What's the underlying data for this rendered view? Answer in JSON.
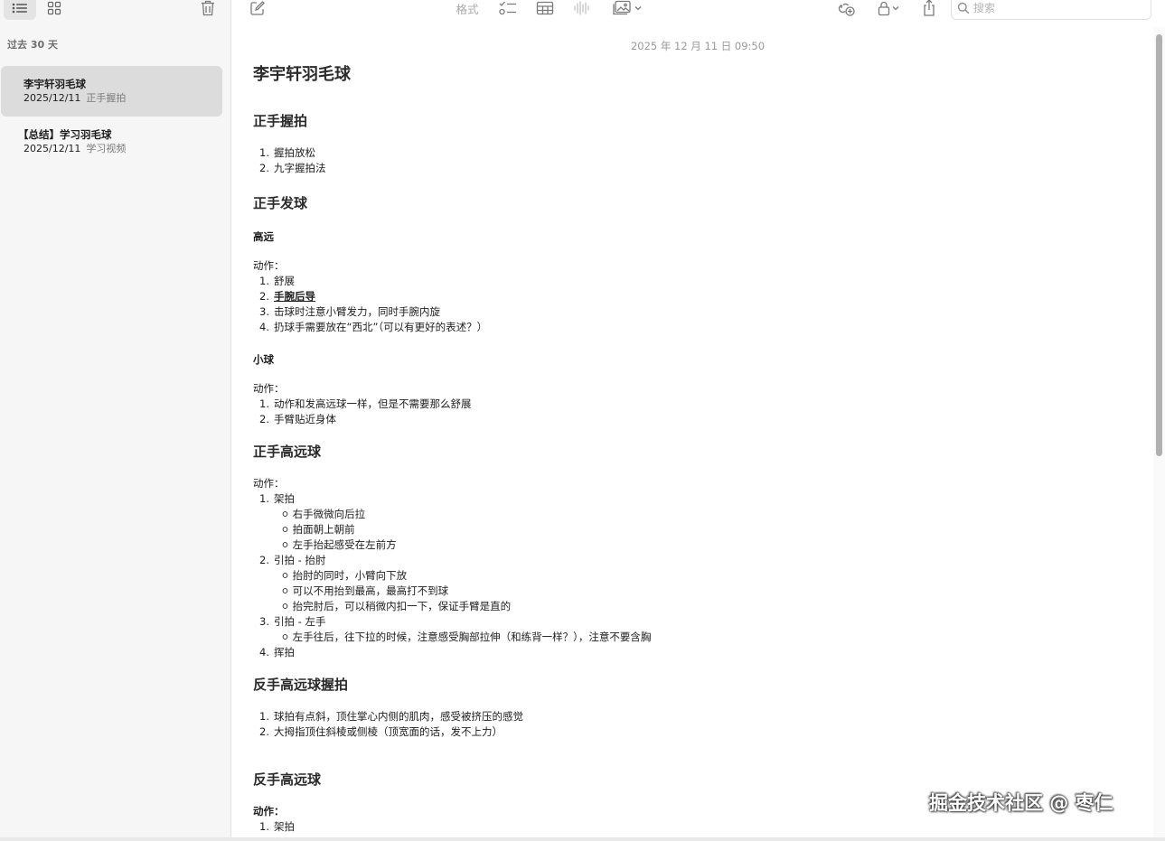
{
  "sidebar": {
    "section_label": "过去 30 天",
    "notes": [
      {
        "title": "李宇轩羽毛球",
        "date": "2025/12/11",
        "preview": "正手握拍",
        "selected": true
      },
      {
        "title": "【总结】学习羽毛球",
        "date": "2025/12/11",
        "preview": "学习视频",
        "selected": false
      }
    ]
  },
  "toolbar": {
    "format_label": "格式",
    "search_placeholder": "搜索"
  },
  "editor": {
    "timestamp": "2025 年 12 月 11 日 09:50",
    "title": "李宇轩羽毛球",
    "s1": {
      "heading": "正手握拍",
      "items": [
        "握拍放松",
        "九字握拍法"
      ]
    },
    "s2": {
      "heading": "正手发球",
      "high": {
        "label": "高远",
        "action": "动作：",
        "items": [
          "舒展",
          "手腕后导",
          "击球时注意小臂发力，同时手腕内旋",
          "扔球手需要放在“西北”（可以有更好的表述？）"
        ]
      },
      "small": {
        "label": "小球",
        "action": "动作：",
        "items": [
          "动作和发高远球一样，但是不需要那么舒展",
          "手臂贴近身体"
        ]
      }
    },
    "s3": {
      "heading": "正手高远球",
      "action": "动作：",
      "items": [
        {
          "text": "架拍",
          "subs": [
            "右手微微向后拉",
            "拍面朝上朝前",
            "左手抬起感受在左前方"
          ]
        },
        {
          "text": "引拍 - 抬肘",
          "subs": [
            "抬肘的同时，小臂向下放",
            "可以不用抬到最高，最高打不到球",
            "抬完肘后，可以稍微内扣一下，保证手臂是直的"
          ]
        },
        {
          "text": "引拍 - 左手",
          "subs": [
            "左手往后，往下拉的时候，注意感受胸部拉伸（和练背一样？），注意不要含胸"
          ]
        },
        {
          "text": "挥拍",
          "subs": []
        }
      ]
    },
    "s4": {
      "heading": "反手高远球握拍",
      "items": [
        "球拍有点斜，顶住掌心内侧的肌肉，感受被挤压的感觉",
        "大拇指顶住斜棱或侧棱（顶宽面的话，发不上力）"
      ]
    },
    "s5": {
      "heading": "反手高远球",
      "action": "动作：",
      "items": [
        "架拍"
      ]
    }
  },
  "watermark": "掘金技术社区 @ 枣仁",
  "colors": {
    "sidebar_bg": "#f6f6f6",
    "selected_bg": "#dcdcdc",
    "icon_gray": "#7a7a7a"
  }
}
